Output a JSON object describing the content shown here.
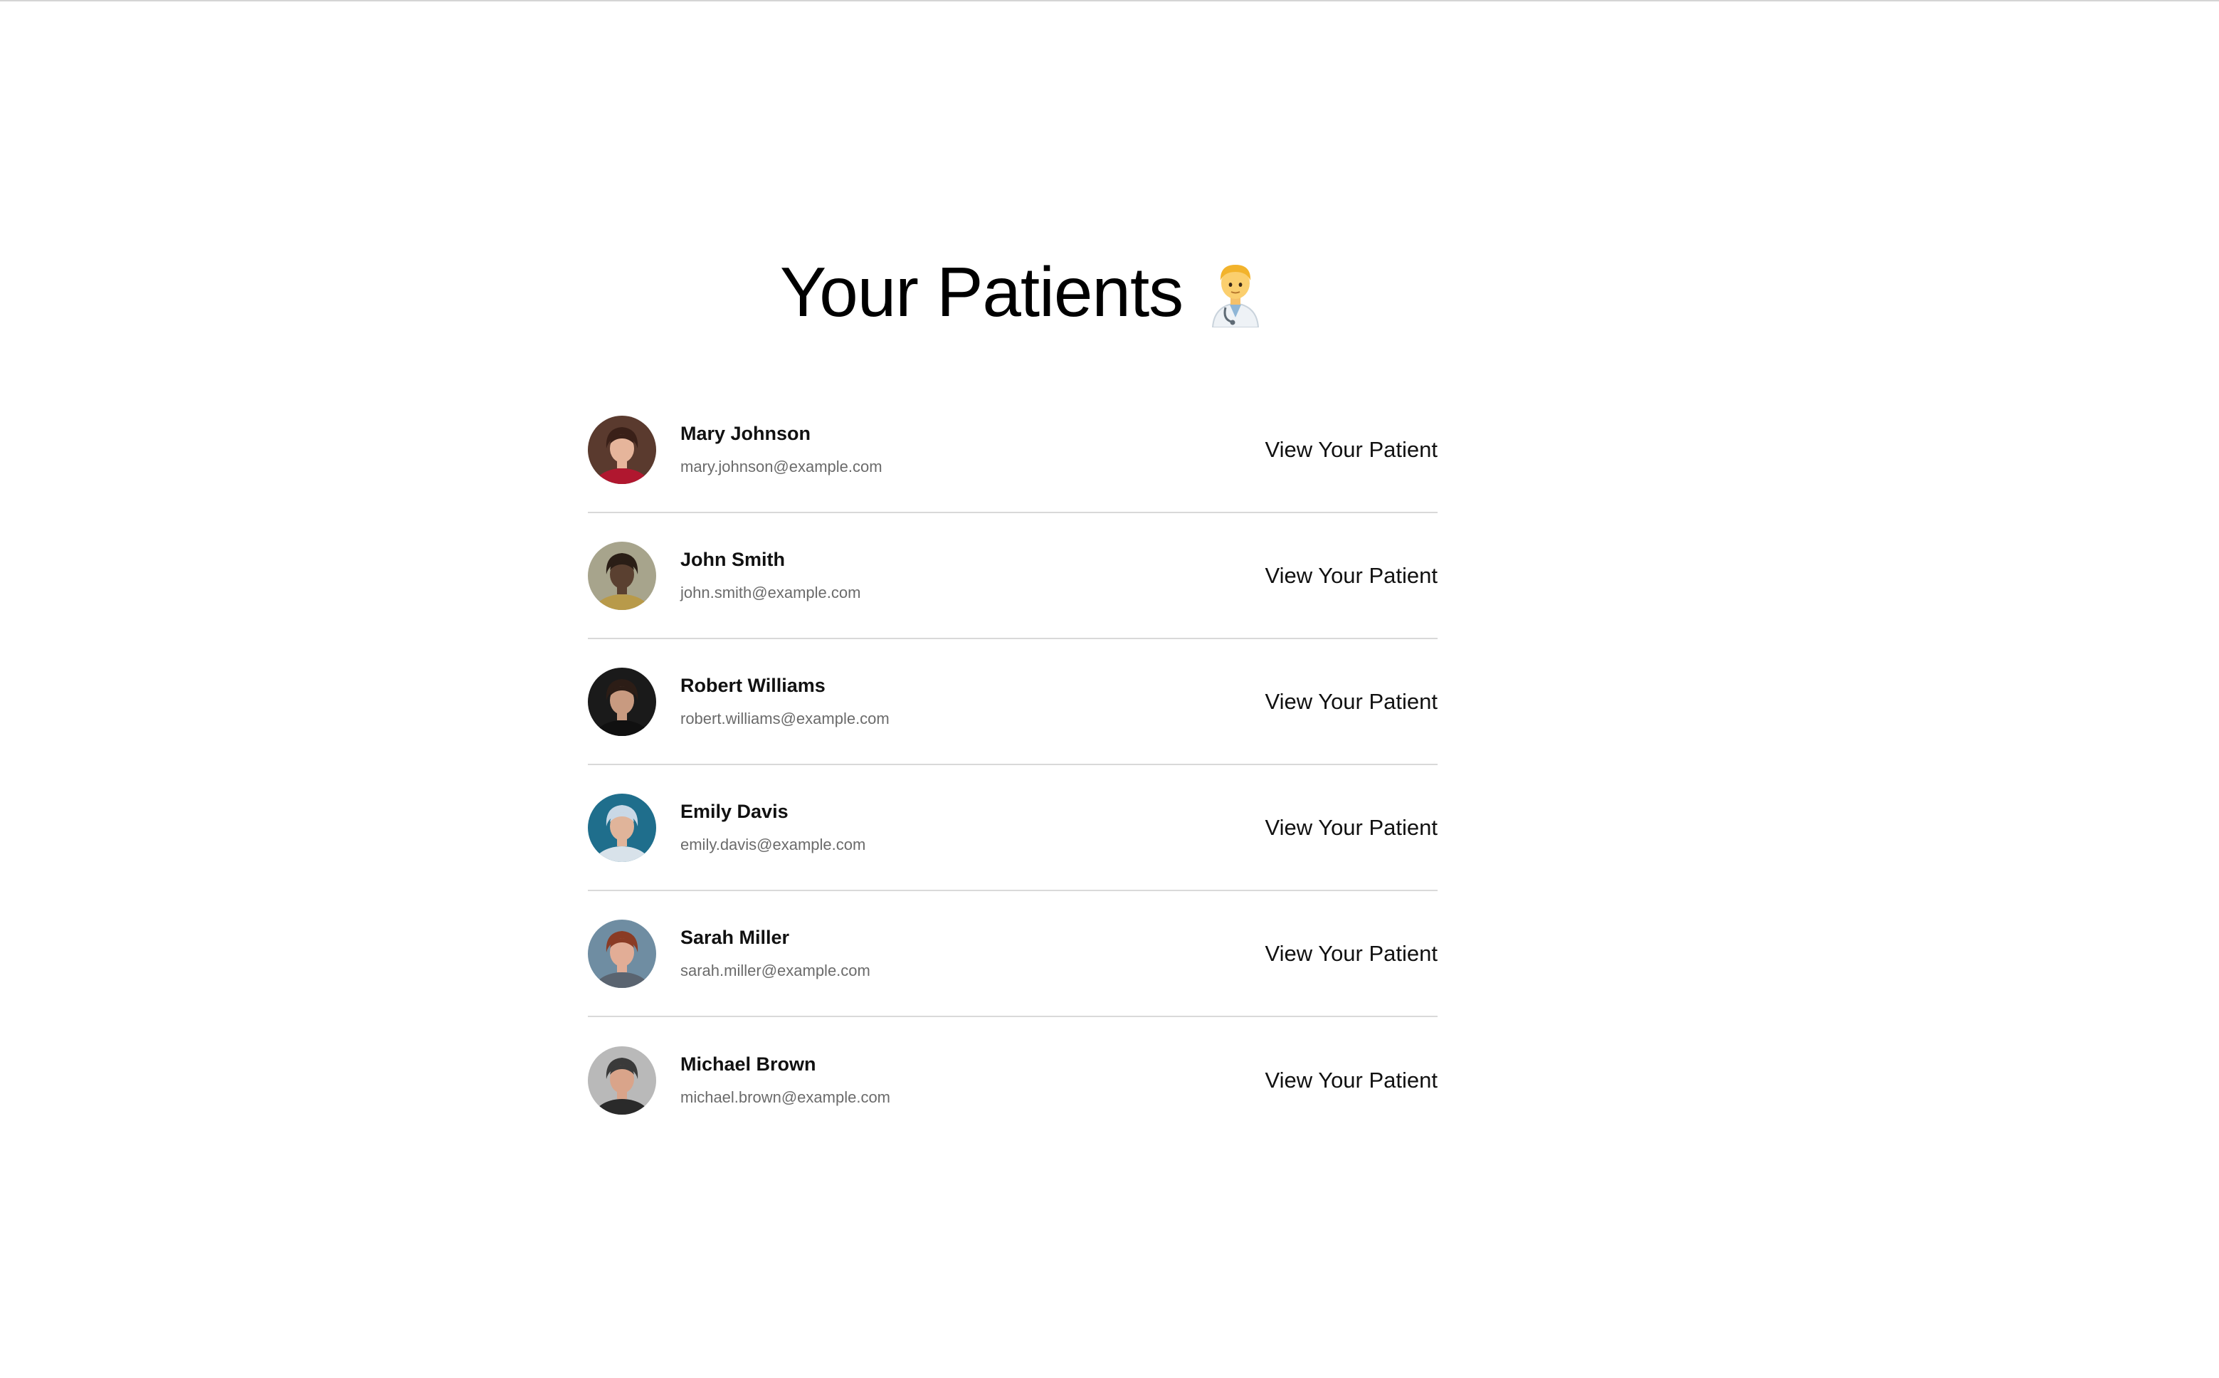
{
  "page": {
    "title": "Your Patients",
    "title_emoji": "health-worker-emoji"
  },
  "patients": [
    {
      "name": "Mary Johnson",
      "email": "mary.johnson@example.com",
      "action_label": "View Your Patient",
      "avatar": "photo-woman-smiling-red-top",
      "avatar_colors": {
        "bg": "#5a3a2e",
        "skin": "#e6b59b",
        "hair": "#3a2018",
        "clothes": "#b0172f"
      }
    },
    {
      "name": "John Smith",
      "email": "john.smith@example.com",
      "action_label": "View Your Patient",
      "avatar": "photo-man-glasses-mustard-top",
      "avatar_colors": {
        "bg": "#a7a48c",
        "skin": "#5a4030",
        "hair": "#2a1e16",
        "clothes": "#b89a4a"
      }
    },
    {
      "name": "Robert Williams",
      "email": "robert.williams@example.com",
      "action_label": "View Your Patient",
      "avatar": "photo-man-dark-background",
      "avatar_colors": {
        "bg": "#1a1a1a",
        "skin": "#c89a80",
        "hair": "#2c1d16",
        "clothes": "#101010"
      }
    },
    {
      "name": "Emily Davis",
      "email": "emily.davis@example.com",
      "action_label": "View Your Patient",
      "avatar": "photo-woman-profile-blue-background",
      "avatar_colors": {
        "bg": "#1f6e8c",
        "skin": "#e0b49a",
        "hair": "#c9d8e6",
        "clothes": "#d8e2ea"
      }
    },
    {
      "name": "Sarah Miller",
      "email": "sarah.miller@example.com",
      "action_label": "View Your Patient",
      "avatar": "photo-woman-auburn-hair",
      "avatar_colors": {
        "bg": "#6f8da2",
        "skin": "#e2ad96",
        "hair": "#8a3b24",
        "clothes": "#5a6470"
      }
    },
    {
      "name": "Michael Brown",
      "email": "michael.brown@example.com",
      "action_label": "View Your Patient",
      "avatar": "photo-bald-man-glasses",
      "avatar_colors": {
        "bg": "#b9b9b9",
        "skin": "#d9a48a",
        "hair": "#3a3a3a",
        "clothes": "#2a2a2a"
      }
    }
  ]
}
